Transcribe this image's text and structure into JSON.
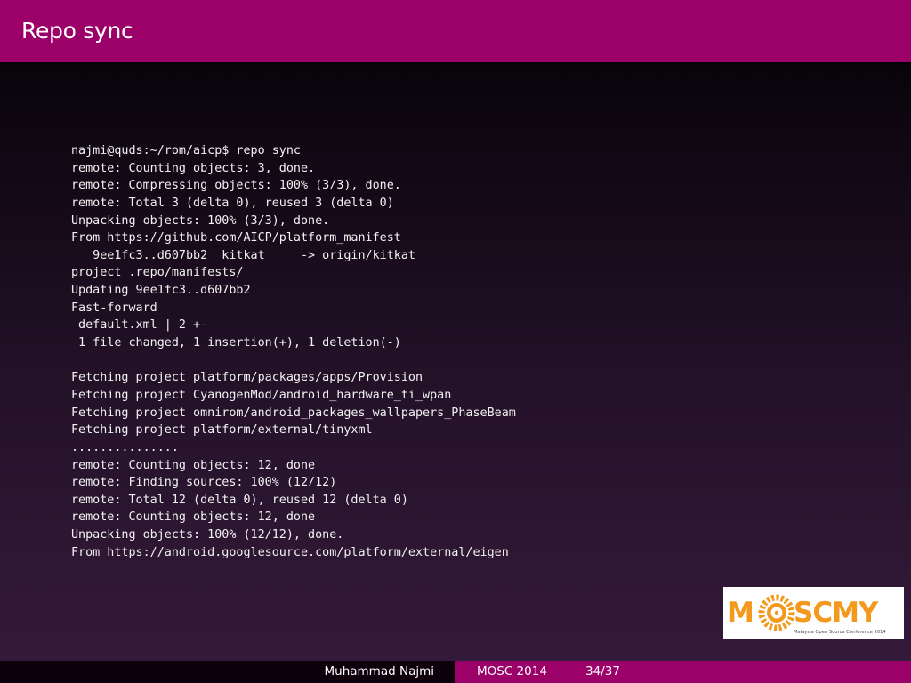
{
  "slide": {
    "title": "Repo sync"
  },
  "terminal": {
    "lines": [
      "najmi@quds:~/rom/aicp$ repo sync",
      "remote: Counting objects: 3, done.",
      "remote: Compressing objects: 100% (3/3), done.",
      "remote: Total 3 (delta 0), reused 3 (delta 0)",
      "Unpacking objects: 100% (3/3), done.",
      "From https://github.com/AICP/platform_manifest",
      "   9ee1fc3..d607bb2  kitkat     -> origin/kitkat",
      "project .repo/manifests/",
      "Updating 9ee1fc3..d607bb2",
      "Fast-forward",
      " default.xml | 2 +-",
      " 1 file changed, 1 insertion(+), 1 deletion(-)",
      "",
      "Fetching project platform/packages/apps/Provision",
      "Fetching project CyanogenMod/android_hardware_ti_wpan",
      "Fetching project omnirom/android_packages_wallpapers_PhaseBeam",
      "Fetching project platform/external/tinyxml",
      "...............",
      "remote: Counting objects: 12, done",
      "remote: Finding sources: 100% (12/12)",
      "remote: Total 12 (delta 0), reused 12 (delta 0)",
      "remote: Counting objects: 12, done",
      "Unpacking objects: 100% (12/12), done.",
      "From https://android.googlesource.com/platform/external/eigen"
    ]
  },
  "logo": {
    "text": "MOSCMY",
    "tagline": "Malaysia Open Source Conference 2014",
    "icon": "gear-logo-icon"
  },
  "footer": {
    "author": "Muhammad Najmi",
    "event": "MOSC 2014",
    "page": "34/37"
  },
  "colors": {
    "accent": "#9c0069",
    "logo_orange": "#f39a1e",
    "terminal_text": "#f2f2f2"
  }
}
